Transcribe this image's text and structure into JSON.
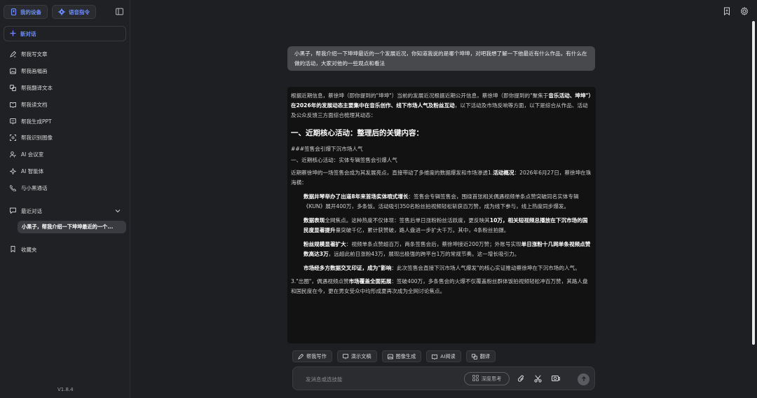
{
  "sidebar": {
    "device_button": "我的设备",
    "voice_button": "语音指令",
    "new_chat": "新对话",
    "items": [
      {
        "label": "帮我写文章",
        "icon": "pen-icon"
      },
      {
        "label": "帮我画幅画",
        "icon": "image-icon"
      },
      {
        "label": "帮我翻译文本",
        "icon": "translate-icon"
      },
      {
        "label": "帮我读文档",
        "icon": "book-icon"
      },
      {
        "label": "帮我生成PPT",
        "icon": "slides-icon"
      },
      {
        "label": "帮我识别图像",
        "icon": "scan-icon"
      },
      {
        "label": "AI 会议室",
        "icon": "meeting-icon"
      },
      {
        "label": "AI 智能体",
        "icon": "sparkle-icon"
      },
      {
        "label": "与小黑通话",
        "icon": "phone-icon"
      }
    ],
    "recent_label": "最近对话",
    "recent_item": "小黑子，帮我介绍一下坤坤最近的一个...",
    "favorites_label": "收藏夹",
    "version": "V1.8.4"
  },
  "chat": {
    "user_message": "小黑子，帮我介绍一下坤坤最近的一个发展近况，你知道我说的是哪个坤坤，对吧我想了解一下他最近有什么作品，有什么在做的活动，大家对他的一些观点和看法",
    "answer": {
      "intro_1": "根据近期信息，蔡徐坤（即你提到的\"坤坤\"）当前的发展近况根据近期公开信息，蔡徐坤（即你提到的\"聚焦于",
      "intro_bold": "音乐活动、坤坤\"）在2026年的发展动态主要集中在音乐创作、线下市场人气及粉丝互动",
      "intro_2": "，以下活动及市场反响等方面，以下是综合从作品、活动及公众反馈三方面综合梳理其动态：",
      "heading": "一、近期核心活动：整理后的关键内容：",
      "raw_1": "###签售会引爆下沉市场人气",
      "raw_2": "一、近期核心活动：实体专辑签售会引爆人气",
      "para_1a": "近期蔡徐坤的一场签售会成为其发展亮点，直接带动了多维度的数据爆发和市场渗透1.",
      "para_1b": "活动概况",
      "para_1c": "：2026年6月27日，蔡徐坤在珠海横：",
      "b1_bold": "数据井琴举办了出道8年来首场实体喷式增长",
      "b1_text": "：签售会专辑签售会，围绕首张相关偶遇视频单条点赞突破同名实体专辑《KUN》展开400万，多条饭。活动吸引350名粉丝拍视频轻松斩获百万赞，成为线下参与，线上热度同步爆发。",
      "b2_bold1": "数据表现",
      "b2_text1": "全网焦点。这种热度不仅体现：签售后单日涨粉粉丝活跃度，更反映其",
      "b2_bold2": "10万，相关短视频总播放在下沉市场的国民度显著提升",
      "b2_text2": "量突破千亿，累计获赞破，路人盘进一步扩大千万。其中，4条粉丝拍摄。",
      "b3_bold1": "粉丝规模显著扩大",
      "b3_text1": "：视频单条点赞超百万，两条签售会后，蔡徐坤接近200万赞；外账号实现",
      "b3_bold2": "单日涨粉十几网单条视频点赞数高达3万",
      "b3_text2": "，远超此前日涨粉43万，展现出极强的跨平台1万的常规节奏。这一增长吸引力。",
      "b4_bold": "市场经多方数据交叉印证，成为\"影响",
      "b4_text": "：此次签售会直接下沉市场人气爆发\"的核心实证推动蔡徐坤在下沉市场的人气。",
      "tail_1": "3.\"出圈\"，偶遇视频点赞",
      "tail_bold": "市场覆盖全面拓展",
      "tail_2": "：签破400万，多条售会的火爆不仅覆盖粉丝群体饭拍视频轻松冲百万赞，其路人盘和国民度在今，更在男女受众中均形成夏再次成为全网讨论焦点。"
    }
  },
  "quick_actions": [
    {
      "label": "帮我写作",
      "icon": "pen-icon"
    },
    {
      "label": "演示文稿",
      "icon": "slides-icon"
    },
    {
      "label": "图像生成",
      "icon": "image-icon"
    },
    {
      "label": "AI阅读",
      "icon": "book-icon"
    },
    {
      "label": "翻译",
      "icon": "translate-icon"
    }
  ],
  "input": {
    "placeholder": "发消息或选技能",
    "deep_think": "深度思考"
  },
  "colors": {
    "accent": "#6b8dff",
    "background": "#1e1f22",
    "sidebar": "#202124",
    "user_bubble": "#48494d"
  }
}
